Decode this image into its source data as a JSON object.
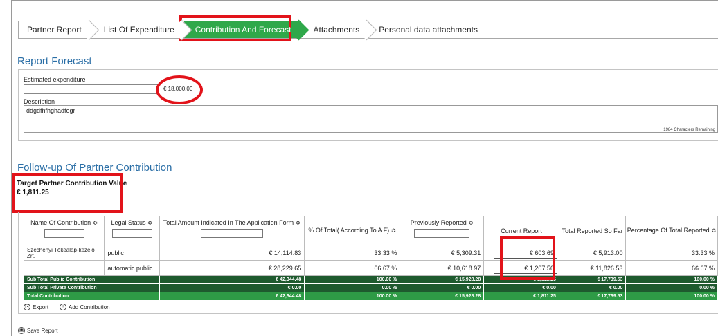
{
  "tabs": [
    {
      "label": "Partner Report"
    },
    {
      "label": "List Of Expenditure"
    },
    {
      "label": "Contribution And Forecast"
    },
    {
      "label": "Attachments"
    },
    {
      "label": "Personal data attachments"
    }
  ],
  "forecast": {
    "title": "Report Forecast",
    "estimated_label": "Estimated expenditure",
    "estimated_value": "€ 18,000.00",
    "description_label": "Description",
    "description_value": "ddgdfhfhghadfegr",
    "chars_remaining": "1984 Characters Remaining"
  },
  "followup": {
    "title": "Follow-up Of Partner Contribution",
    "target_label": "Target Partner Contribution Value",
    "target_value": "€ 1,811.25"
  },
  "table": {
    "headers": {
      "name": "Name Of Contribution ≎",
      "legal": "Legal Status ≎",
      "total_app": "Total Amount Indicated In The Application Form ≎",
      "pct_total": "% Of Total( According To A F) ≎",
      "prev": "Previously Reported ≎",
      "current": "Current Report",
      "total_so_far": "Total Reported So Far",
      "pct_reported": "Percentage Of Total Reported ≎"
    },
    "rows": [
      {
        "name": "Széchenyi Tőkealap-kezelő Zrt.",
        "legal": "public",
        "total_app": "€ 14,114.83",
        "pct_total": "33.33 %",
        "prev": "€ 5,309.31",
        "current": "€ 603.69",
        "total_so_far": "€ 5,913.00",
        "pct_reported": "33.33 %"
      },
      {
        "name": "",
        "legal": "automatic public",
        "total_app": "€ 28,229.65",
        "pct_total": "66.67 %",
        "prev": "€ 10,618.97",
        "current": "€ 1,207.56",
        "total_so_far": "€ 11,826.53",
        "pct_reported": "66.67 %"
      }
    ],
    "subtotal_public": {
      "label": "Sub Total Public Contribution",
      "total_app": "€ 42,344.48",
      "pct_total": "100.00 %",
      "prev": "€ 15,928.28",
      "current": "€ 1,811.25",
      "total_so_far": "€ 17,739.53",
      "pct_reported": "100.00 %"
    },
    "subtotal_private": {
      "label": "Sub Total Private Contribution",
      "total_app": "€ 0.00",
      "pct_total": "0.00 %",
      "prev": "€ 0.00",
      "current": "€ 0.00",
      "total_so_far": "€ 0.00",
      "pct_reported": "0.00 %"
    },
    "total": {
      "label": "Total Contribution",
      "total_app": "€ 42,344.48",
      "pct_total": "100.00 %",
      "prev": "€ 15,928.28",
      "current": "€ 1,811.25",
      "total_so_far": "€ 17,739.53",
      "pct_reported": "100.00 %"
    }
  },
  "actions": {
    "export": "Export",
    "add_contribution": "Add Contribution",
    "save_report": "Save Report"
  },
  "colors": {
    "accent_green": "#2fa84a",
    "dark_green": "#1e5a2e",
    "highlight_red": "#e2131a",
    "title_blue": "#2a6ea6"
  }
}
